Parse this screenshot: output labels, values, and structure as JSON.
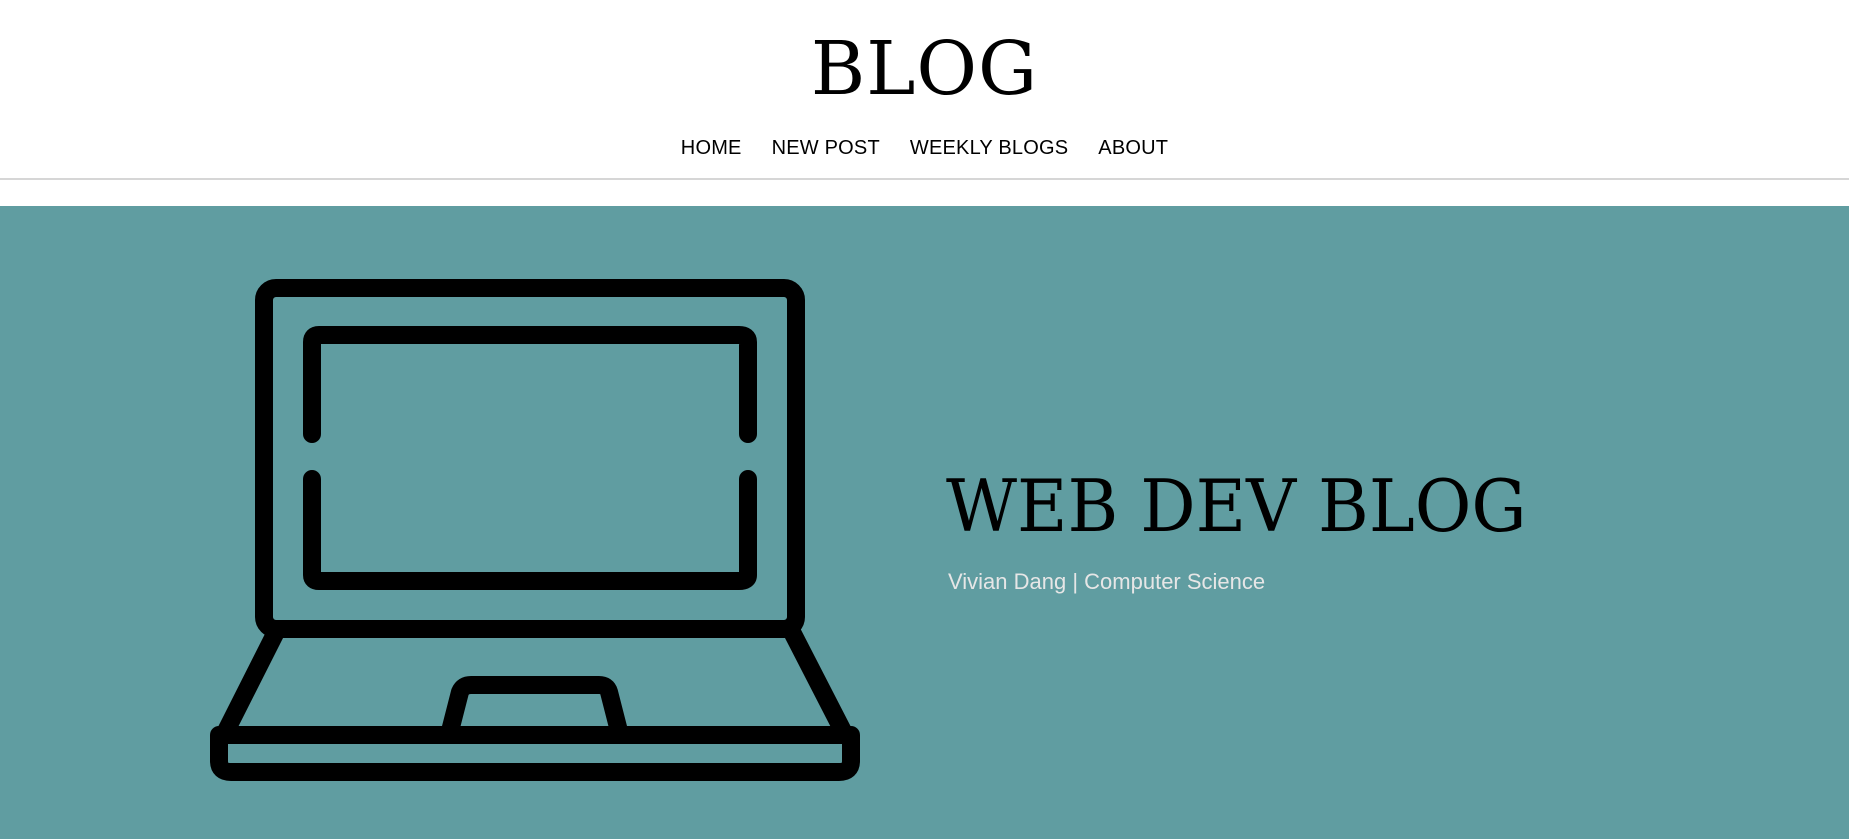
{
  "header": {
    "site_title": "BLOG",
    "nav": [
      {
        "label": "HOME"
      },
      {
        "label": "NEW POST"
      },
      {
        "label": "WEEKLY BLOGS"
      },
      {
        "label": "ABOUT"
      }
    ]
  },
  "hero": {
    "title": "WEB DEV BLOG",
    "subtitle": "Vivian Dang | Computer Science",
    "image_icon": "laptop-icon",
    "background_color": "#609da1"
  }
}
